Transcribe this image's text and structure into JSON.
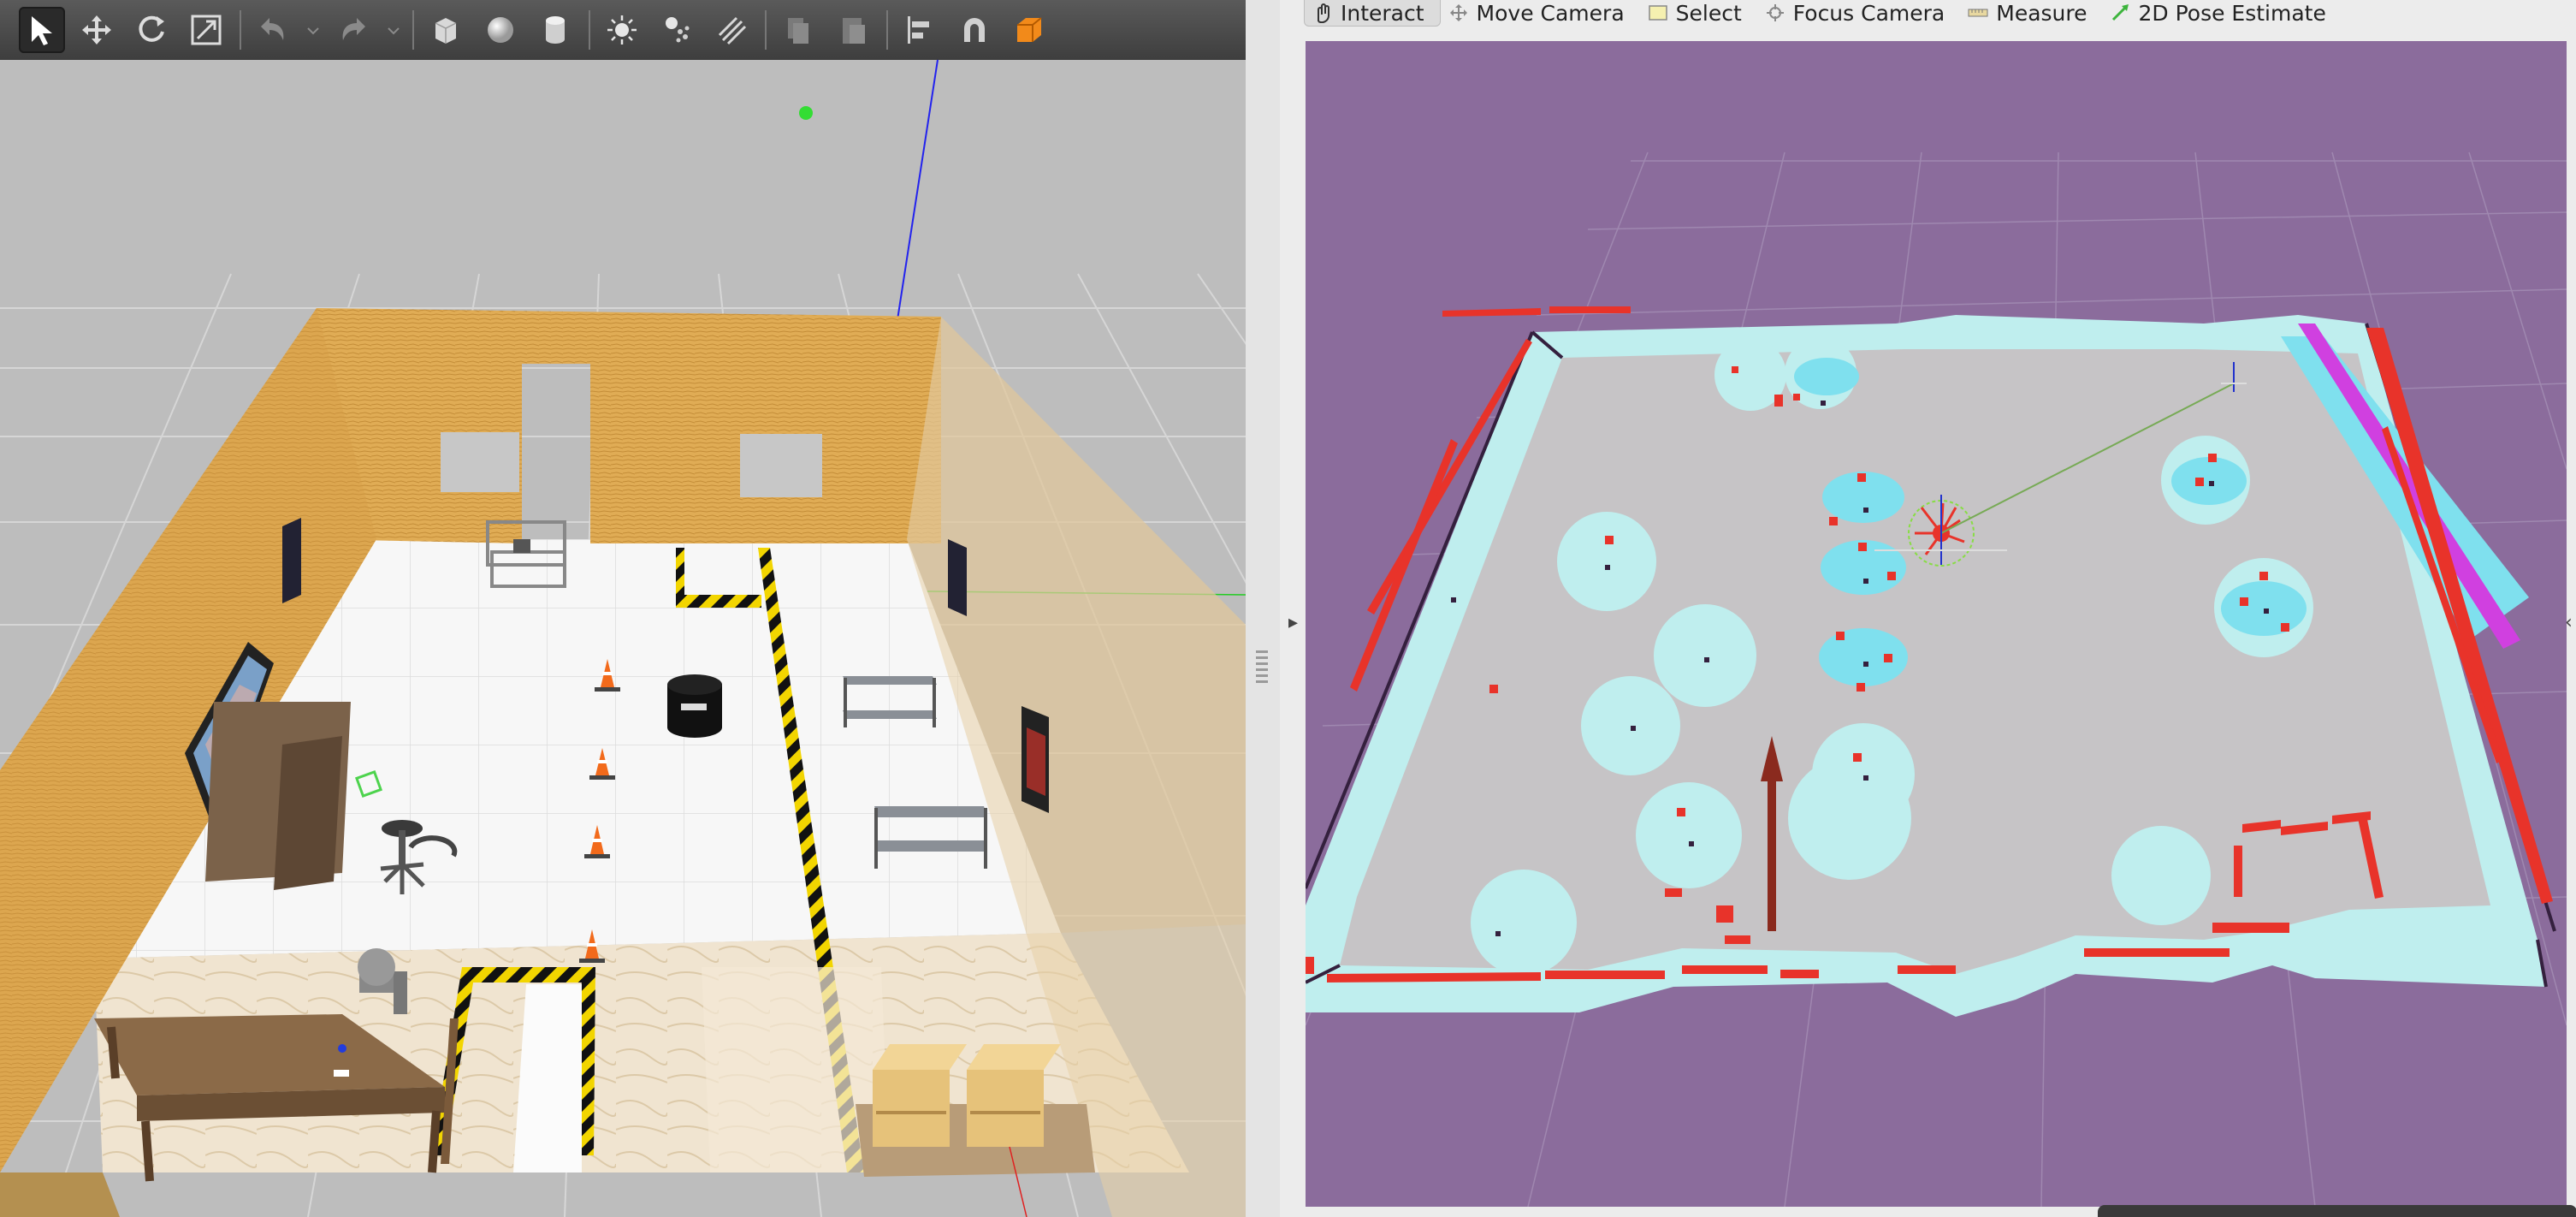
{
  "gazebo": {
    "toolbar": {
      "tools": [
        {
          "icon": "select-arrow-icon",
          "active": true
        },
        {
          "icon": "translate-icon",
          "active": false
        },
        {
          "icon": "rotate-icon",
          "active": false
        },
        {
          "icon": "scale-icon",
          "active": false
        },
        {
          "icon": "undo-icon",
          "active": false
        },
        {
          "icon": "redo-icon",
          "active": false
        },
        {
          "icon": "box-shape-icon",
          "active": false
        },
        {
          "icon": "sphere-shape-icon",
          "active": false
        },
        {
          "icon": "cylinder-shape-icon",
          "active": false
        },
        {
          "icon": "point-light-icon",
          "active": false
        },
        {
          "icon": "spot-light-icon",
          "active": false
        },
        {
          "icon": "directional-light-icon",
          "active": false
        },
        {
          "icon": "copy-icon",
          "active": false
        },
        {
          "icon": "paste-icon",
          "active": false
        },
        {
          "icon": "align-icon",
          "active": false
        },
        {
          "icon": "snap-magnet-icon",
          "active": false
        },
        {
          "icon": "change-view-icon",
          "active": false
        }
      ]
    },
    "scene": {
      "description_icon": "warehouse-3d-scene"
    }
  },
  "rviz": {
    "toolbar": {
      "tools": [
        {
          "label": "Interact",
          "icon": "interact-hand-icon",
          "active": true
        },
        {
          "label": "Move Camera",
          "icon": "move-camera-icon",
          "active": false
        },
        {
          "label": "Select",
          "icon": "select-box-icon",
          "active": false
        },
        {
          "label": "Focus Camera",
          "icon": "focus-camera-icon",
          "active": false
        },
        {
          "label": "Measure",
          "icon": "measure-ruler-icon",
          "active": false
        },
        {
          "label": "2D Pose Estimate",
          "icon": "pose-estimate-arrow-icon",
          "active": false
        }
      ]
    },
    "colors": {
      "background": "#8b6c9c",
      "free_space": "#c8c8c8",
      "inflation": "#bfeeee",
      "obstacle": "#e8332a",
      "laser": "#e8332a",
      "path_arrow": "#8a2a1e",
      "lethal": "#00e5ff"
    }
  }
}
